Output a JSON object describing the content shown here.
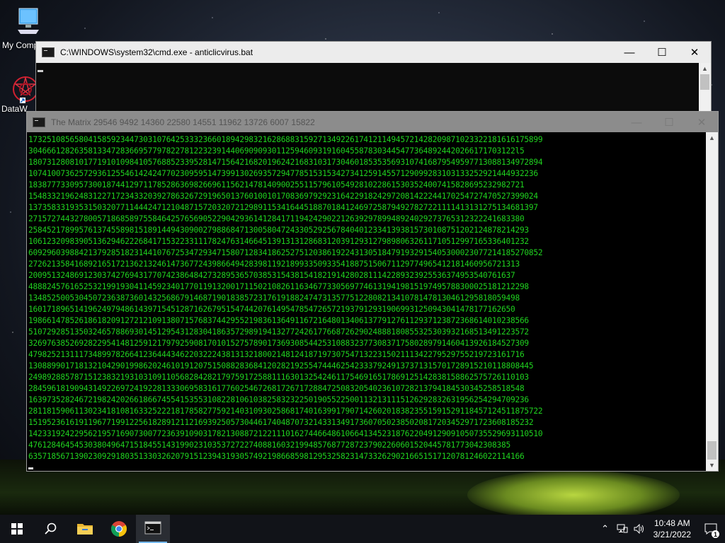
{
  "desktop": {
    "icons": [
      {
        "label": "My Computer",
        "icon": "computer-icon"
      },
      {
        "label": "DataW",
        "icon": "datawin-icon"
      }
    ]
  },
  "window_cmd": {
    "title": "C:\\WINDOWS\\system32\\cmd.exe - anticlicvirus.bat",
    "icon": "cmd-icon"
  },
  "window_matrix": {
    "title": "The Matrix 29546 9492 14360 22580 14551 11962 13726 6007 15822",
    "icon": "cmd-icon",
    "text_color": "#1fd21f",
    "lines": [
      "1732510856580415859234473031076425333236601894298321628688315927134922617412114945721428209871023322181616175899",
      "3046661282635813347283669577978227812232391440690909301125946093191604558783034454773648924420266171703122l5",
      "1807312808101771910109841057688523395281471564216820196242168310317304601853535693107416879549597713088134972894",
      "107410073625729361255461424247702309595147399130269357294778515315342734125914557129099283103133252921444932236",
      "183877733095730018744129711785286369826696115621478140900255115796105492810228615303524007415828695232982721",
      "154833219624831227172343320392786326729196501376010010170836979292316422918242972081422244170254727470527399024",
      "137358331935315032077114442471210487157203207212989115341644518870184124697258794927827221111413131275134681397",
      "271572744327800571868589755846425765690522904293614128417119424290221263929789948924029273765312322241683380",
      "2584521789957613745589815189144943090027988684713005804724330529256784040123341393815730108751202124878214293",
      "1061232098390513629462226841715322331117824763146645139131312868312039129312798980632611710512997165336401232",
      "6092960398842137928518231441076725347293471580712834186252751203861922431305184791932915405300023077214185270852",
      "27262135841689216517213621324614736772439866494283981192189933509335418875150671129774965412181460956721313",
      "2009513248691230374276943177074238648427328953657038531543815418219142802811142289323925536374953540761637",
      "4888245761652532199193041145923401770119132001711502108261163467733056977461319419815197495788300025181212298",
      "13485250053045072363873601432568679146871901838572317619188247473135775122808213410781478130461295818059498",
      "1601718965141962497948614397154512871626795154744207614954785472657219379129319069931250943041478177162650",
      "1986614785261861820912721210913807157683744295521983613649116721648013406137791276112937123872368614010238566",
      "5107292851350324657886930145129543128304186357298919413277242617766872629024888180855325303932168513491223572",
      "3269763852692822954148125912179792590817010152757890173693085442531088323773083717580289791460413926184527309",
      "479825213111734899782664123644434622032224381313218002148124187197307547132231502111342279529755219723161716",
      "13088990171813210429019986202461019120751508828368412028219255474446254233379249137371315701728915210118808445",
      "2498928857871512383219310310911056828428217975917258811163013254246117546916517869125142838158862575726110103",
      "284596181909431492269724192281333069583161776025467268172671728847250832054023610728213794184530345258518548",
      "1639735282467219824202661866745541535531082281061038258323225019055225001132131115126292832631956254294709236",
      "2811815906113023418108163325222181785827759214031093025868174016399179071426020183823551591529118457124511875722",
      "15195236161911967719912256182891211216939250573044617404870732143313491736070502385020817203452971723608185232",
      "1423319242295621957169073007723639109031782130887212211101627446648610664134523187622049129091050735529693110510",
      "476128464545303804964715184551431990231035372722740881603219948576877287237902260601520445781773042308385",
      "635718567139023092918035133032620791512394319305749219866859812953258231473326290216651517120781246022114166"
    ]
  },
  "taskbar": {
    "items": [
      {
        "name": "start-button",
        "icon": "windows-logo-icon"
      },
      {
        "name": "search-button",
        "icon": "search-icon"
      },
      {
        "name": "file-explorer-button",
        "icon": "folder-icon"
      },
      {
        "name": "chrome-button",
        "icon": "chrome-icon"
      },
      {
        "name": "cmd-taskbar-button",
        "icon": "cmd-icon"
      }
    ],
    "clock_time": "10:48 AM",
    "clock_date": "3/21/2022",
    "notification_count": "1"
  }
}
